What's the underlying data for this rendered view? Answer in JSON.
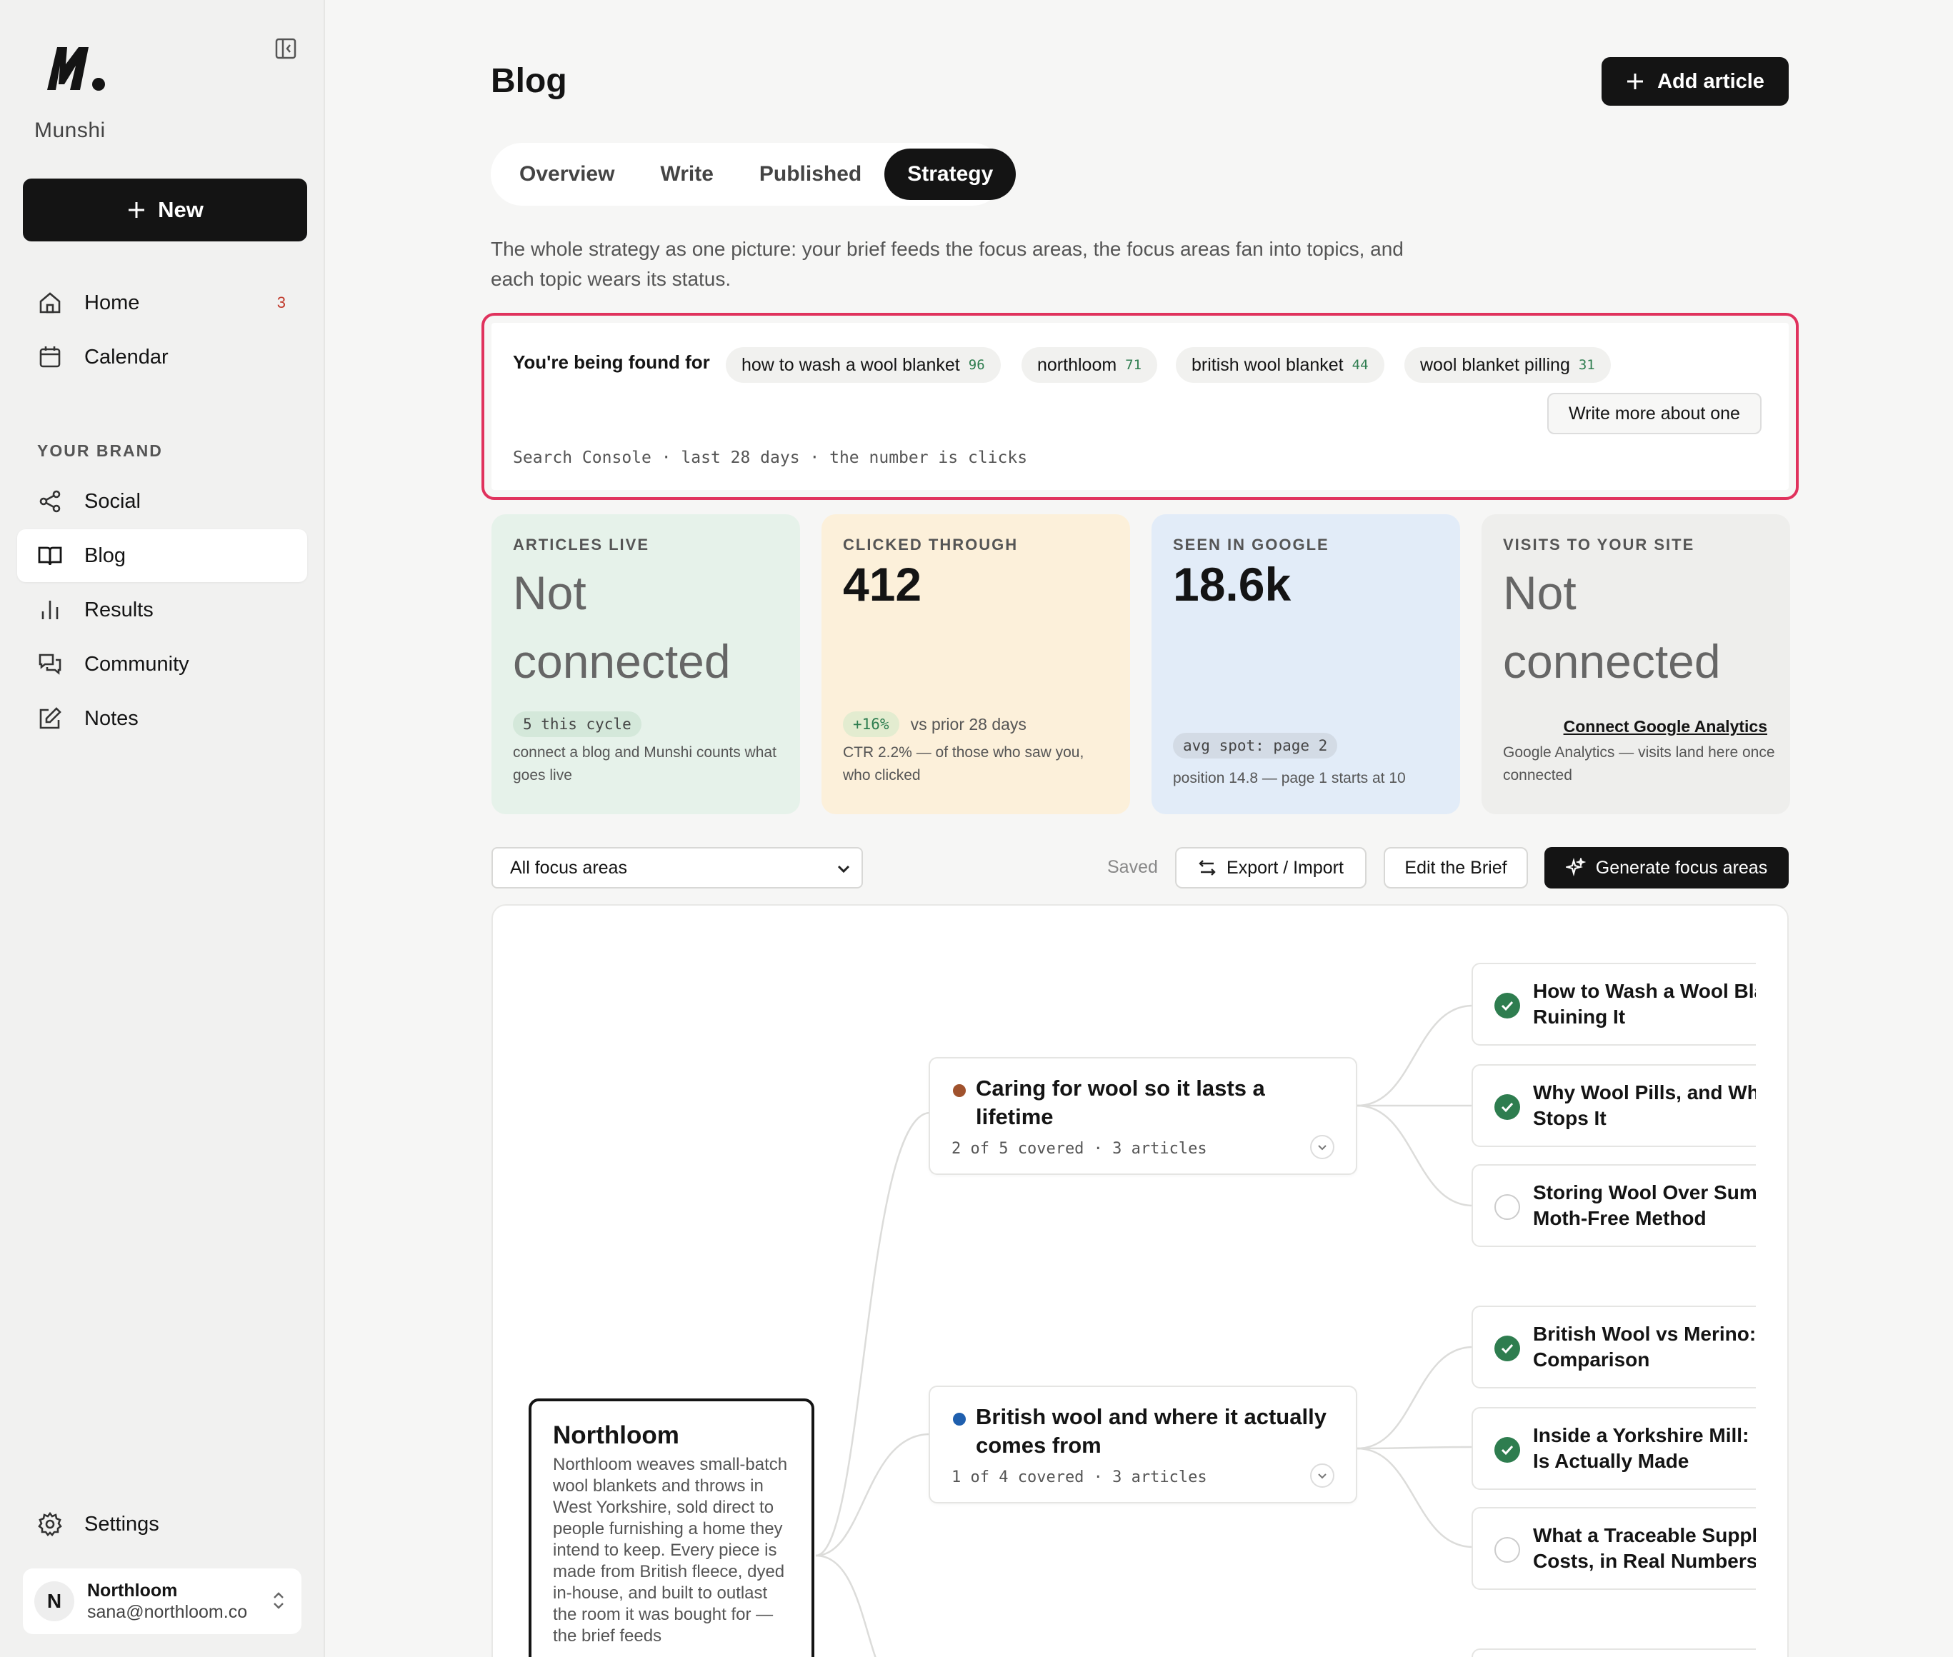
{
  "app": {
    "brand": "Munshi"
  },
  "sidebar": {
    "new_label": "New",
    "items": [
      {
        "label": "Home",
        "badge": "3"
      },
      {
        "label": "Calendar"
      }
    ],
    "section_label": "YOUR BRAND",
    "brand_items": [
      {
        "label": "Social"
      },
      {
        "label": "Blog"
      },
      {
        "label": "Results"
      },
      {
        "label": "Community"
      },
      {
        "label": "Notes"
      }
    ],
    "settings_label": "Settings",
    "account": {
      "initial": "N",
      "name": "Northloom",
      "email": "sana@northloom.co"
    }
  },
  "header": {
    "title": "Blog",
    "add_label": "Add article"
  },
  "tabs": [
    "Overview",
    "Write",
    "Published",
    "Strategy"
  ],
  "active_tab": "Strategy",
  "intro": "The whole strategy as one picture: your brief feeds the focus areas, the focus areas fan into topics, and each topic wears its status.",
  "found": {
    "label": "You're being found for",
    "queries": [
      {
        "q": "how to wash a wool blanket",
        "n": "96"
      },
      {
        "q": "northloom",
        "n": "71"
      },
      {
        "q": "british wool blanket",
        "n": "44"
      },
      {
        "q": "wool blanket pilling",
        "n": "31"
      }
    ],
    "write_more": "Write more about one",
    "note": "Search Console · last 28 days · the number is clicks"
  },
  "cards": [
    {
      "label": "ARTICLES LIVE",
      "value": "Not connected",
      "pill": "5 this cycle",
      "sub": "connect a blog and Munshi counts what goes live"
    },
    {
      "label": "CLICKED THROUGH",
      "value": "412",
      "pill": "+16%",
      "pill_note": "vs prior 28 days",
      "sub": "CTR 2.2% — of those who saw you, who clicked"
    },
    {
      "label": "SEEN IN GOOGLE",
      "value": "18.6k",
      "pill": "avg spot: page 2",
      "sub": "position 14.8 — page 1 starts at 10"
    },
    {
      "label": "VISITS TO YOUR SITE",
      "value": "Not connected",
      "link": "Connect Google Analytics",
      "sub": "Google Analytics — visits land here once connected"
    }
  ],
  "toolbar": {
    "filter": "All focus areas",
    "saved": "Saved",
    "export_label": "Export / Import",
    "edit_label": "Edit the Brief",
    "generate_label": "Generate focus areas"
  },
  "map": {
    "root": {
      "title": "Northloom",
      "desc": "Northloom weaves small-batch wool blankets and throws in West Yorkshire, sold direct to people furnishing a home they intend to keep. Every piece is made from British fleece, dyed in-house, and built to outlast the room it was bought for — the brief feeds"
    },
    "focus_areas": [
      {
        "title": "Caring for wool so it lasts a lifetime",
        "meta": "2 of 5 covered · 3 articles",
        "color": "#a0522d",
        "topics": [
          {
            "title": "How to Wash a Wool Bla",
            "title2": "Ruining It",
            "done": true
          },
          {
            "title": "Why Wool Pills, and Wha",
            "title2": "Stops It",
            "done": true
          },
          {
            "title": "Storing Wool Over Sumr",
            "title2": "Moth-Free Method",
            "done": false
          }
        ]
      },
      {
        "title": "British wool and where it actually comes from",
        "meta": "1 of 4 covered · 3 articles",
        "color": "#1f5fae",
        "topics": [
          {
            "title": "British Wool vs Merino: ",
            "title2": "Comparison",
            "done": true
          },
          {
            "title": "Inside a Yorkshire Mill: H",
            "title2": "Is Actually Made",
            "done": true
          },
          {
            "title": "What a Traceable Suppl",
            "title2": "Costs, in Real Numbers",
            "done": false
          }
        ]
      }
    ]
  }
}
